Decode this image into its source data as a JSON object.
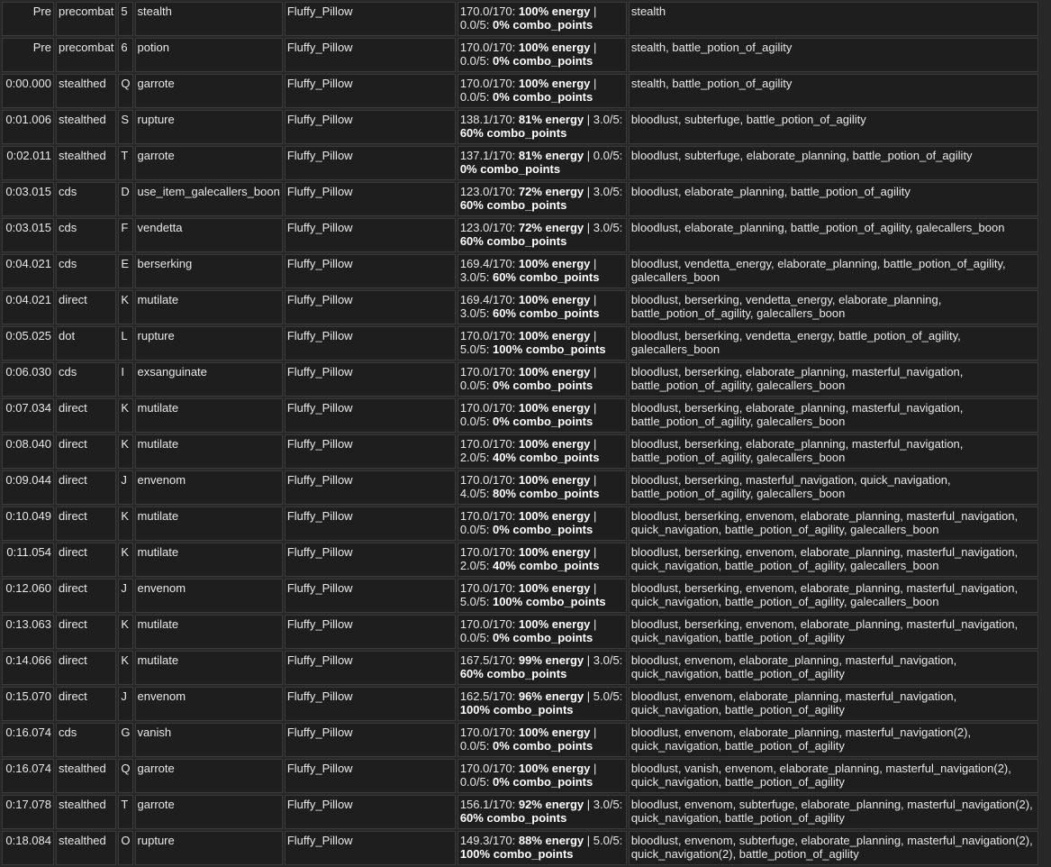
{
  "rows": [
    {
      "time": "Pre",
      "list": "precombat",
      "key": "5",
      "action": "stealth",
      "target": "Fluffy_Pillow",
      "r1": "170.0/170: ",
      "r2": "100% energy",
      "r3": " | 0.0/5: ",
      "r4": "0% combo_points",
      "buffs": "stealth"
    },
    {
      "time": "Pre",
      "list": "precombat",
      "key": "6",
      "action": "potion",
      "target": "Fluffy_Pillow",
      "r1": "170.0/170: ",
      "r2": "100% energy",
      "r3": " | 0.0/5: ",
      "r4": "0% combo_points",
      "buffs": "stealth, battle_potion_of_agility"
    },
    {
      "time": "0:00.000",
      "list": "stealthed",
      "key": "Q",
      "action": "garrote",
      "target": "Fluffy_Pillow",
      "r1": "170.0/170: ",
      "r2": "100% energy",
      "r3": " | 0.0/5: ",
      "r4": "0% combo_points",
      "buffs": "stealth, battle_potion_of_agility"
    },
    {
      "time": "0:01.006",
      "list": "stealthed",
      "key": "S",
      "action": "rupture",
      "target": "Fluffy_Pillow",
      "r1": "138.1/170: ",
      "r2": "81% energy",
      "r3": " | 3.0/5: ",
      "r4": "60% combo_points",
      "buffs": "bloodlust, subterfuge, battle_potion_of_agility"
    },
    {
      "time": "0:02.011",
      "list": "stealthed",
      "key": "T",
      "action": "garrote",
      "target": "Fluffy_Pillow",
      "r1": "137.1/170: ",
      "r2": "81% energy",
      "r3": " | 0.0/5: ",
      "r4": "0% combo_points",
      "buffs": "bloodlust, subterfuge, elaborate_planning, battle_potion_of_agility"
    },
    {
      "time": "0:03.015",
      "list": "cds",
      "key": "D",
      "action": "use_item_galecallers_boon",
      "target": "Fluffy_Pillow",
      "r1": "123.0/170: ",
      "r2": "72% energy",
      "r3": " | 3.0/5: ",
      "r4": "60% combo_points",
      "buffs": "bloodlust, elaborate_planning, battle_potion_of_agility"
    },
    {
      "time": "0:03.015",
      "list": "cds",
      "key": "F",
      "action": "vendetta",
      "target": "Fluffy_Pillow",
      "r1": "123.0/170: ",
      "r2": "72% energy",
      "r3": " | 3.0/5: ",
      "r4": "60% combo_points",
      "buffs": "bloodlust, elaborate_planning, battle_potion_of_agility, galecallers_boon"
    },
    {
      "time": "0:04.021",
      "list": "cds",
      "key": "E",
      "action": "berserking",
      "target": "Fluffy_Pillow",
      "r1": "169.4/170: ",
      "r2": "100% energy",
      "r3": " | 3.0/5: ",
      "r4": "60% combo_points",
      "buffs": "bloodlust, vendetta_energy, elaborate_planning, battle_potion_of_agility, galecallers_boon"
    },
    {
      "time": "0:04.021",
      "list": "direct",
      "key": "K",
      "action": "mutilate",
      "target": "Fluffy_Pillow",
      "r1": "169.4/170: ",
      "r2": "100% energy",
      "r3": " | 3.0/5: ",
      "r4": "60% combo_points",
      "buffs": "bloodlust, berserking, vendetta_energy, elaborate_planning, battle_potion_of_agility, galecallers_boon"
    },
    {
      "time": "0:05.025",
      "list": "dot",
      "key": "L",
      "action": "rupture",
      "target": "Fluffy_Pillow",
      "r1": "170.0/170: ",
      "r2": "100% energy",
      "r3": " | 5.0/5: ",
      "r4": "100% combo_points",
      "buffs": "bloodlust, berserking, vendetta_energy, battle_potion_of_agility, galecallers_boon"
    },
    {
      "time": "0:06.030",
      "list": "cds",
      "key": "I",
      "action": "exsanguinate",
      "target": "Fluffy_Pillow",
      "r1": "170.0/170: ",
      "r2": "100% energy",
      "r3": " | 0.0/5: ",
      "r4": "0% combo_points",
      "buffs": "bloodlust, berserking, elaborate_planning, masterful_navigation, battle_potion_of_agility, galecallers_boon"
    },
    {
      "time": "0:07.034",
      "list": "direct",
      "key": "K",
      "action": "mutilate",
      "target": "Fluffy_Pillow",
      "r1": "170.0/170: ",
      "r2": "100% energy",
      "r3": " | 0.0/5: ",
      "r4": "0% combo_points",
      "buffs": "bloodlust, berserking, elaborate_planning, masterful_navigation, battle_potion_of_agility, galecallers_boon"
    },
    {
      "time": "0:08.040",
      "list": "direct",
      "key": "K",
      "action": "mutilate",
      "target": "Fluffy_Pillow",
      "r1": "170.0/170: ",
      "r2": "100% energy",
      "r3": " | 2.0/5: ",
      "r4": "40% combo_points",
      "buffs": "bloodlust, berserking, elaborate_planning, masterful_navigation, battle_potion_of_agility, galecallers_boon"
    },
    {
      "time": "0:09.044",
      "list": "direct",
      "key": "J",
      "action": "envenom",
      "target": "Fluffy_Pillow",
      "r1": "170.0/170: ",
      "r2": "100% energy",
      "r3": " | 4.0/5: ",
      "r4": "80% combo_points",
      "buffs": "bloodlust, berserking, masterful_navigation, quick_navigation, battle_potion_of_agility, galecallers_boon"
    },
    {
      "time": "0:10.049",
      "list": "direct",
      "key": "K",
      "action": "mutilate",
      "target": "Fluffy_Pillow",
      "r1": "170.0/170: ",
      "r2": "100% energy",
      "r3": " | 0.0/5: ",
      "r4": "0% combo_points",
      "buffs": "bloodlust, berserking, envenom, elaborate_planning, masterful_navigation, quick_navigation, battle_potion_of_agility, galecallers_boon"
    },
    {
      "time": "0:11.054",
      "list": "direct",
      "key": "K",
      "action": "mutilate",
      "target": "Fluffy_Pillow",
      "r1": "170.0/170: ",
      "r2": "100% energy",
      "r3": " | 2.0/5: ",
      "r4": "40% combo_points",
      "buffs": "bloodlust, berserking, envenom, elaborate_planning, masterful_navigation, quick_navigation, battle_potion_of_agility, galecallers_boon"
    },
    {
      "time": "0:12.060",
      "list": "direct",
      "key": "J",
      "action": "envenom",
      "target": "Fluffy_Pillow",
      "r1": "170.0/170: ",
      "r2": "100% energy",
      "r3": " | 5.0/5: ",
      "r4": "100% combo_points",
      "buffs": "bloodlust, berserking, envenom, elaborate_planning, masterful_navigation, quick_navigation, battle_potion_of_agility, galecallers_boon"
    },
    {
      "time": "0:13.063",
      "list": "direct",
      "key": "K",
      "action": "mutilate",
      "target": "Fluffy_Pillow",
      "r1": "170.0/170: ",
      "r2": "100% energy",
      "r3": " | 0.0/5: ",
      "r4": "0% combo_points",
      "buffs": "bloodlust, berserking, envenom, elaborate_planning, masterful_navigation, quick_navigation, battle_potion_of_agility"
    },
    {
      "time": "0:14.066",
      "list": "direct",
      "key": "K",
      "action": "mutilate",
      "target": "Fluffy_Pillow",
      "r1": "167.5/170: ",
      "r2": "99% energy",
      "r3": " | 3.0/5: ",
      "r4": "60% combo_points",
      "buffs": "bloodlust, envenom, elaborate_planning, masterful_navigation, quick_navigation, battle_potion_of_agility"
    },
    {
      "time": "0:15.070",
      "list": "direct",
      "key": "J",
      "action": "envenom",
      "target": "Fluffy_Pillow",
      "r1": "162.5/170: ",
      "r2": "96% energy",
      "r3": " | 5.0/5: ",
      "r4": "100% combo_points",
      "buffs": "bloodlust, envenom, elaborate_planning, masterful_navigation, quick_navigation, battle_potion_of_agility"
    },
    {
      "time": "0:16.074",
      "list": "cds",
      "key": "G",
      "action": "vanish",
      "target": "Fluffy_Pillow",
      "r1": "170.0/170: ",
      "r2": "100% energy",
      "r3": " | 0.0/5: ",
      "r4": "0% combo_points",
      "buffs": "bloodlust, envenom, elaborate_planning, masterful_navigation(2), quick_navigation, battle_potion_of_agility"
    },
    {
      "time": "0:16.074",
      "list": "stealthed",
      "key": "Q",
      "action": "garrote",
      "target": "Fluffy_Pillow",
      "r1": "170.0/170: ",
      "r2": "100% energy",
      "r3": " | 0.0/5: ",
      "r4": "0% combo_points",
      "buffs": "bloodlust, vanish, envenom, elaborate_planning, masterful_navigation(2), quick_navigation, battle_potion_of_agility"
    },
    {
      "time": "0:17.078",
      "list": "stealthed",
      "key": "T",
      "action": "garrote",
      "target": "Fluffy_Pillow",
      "r1": "156.1/170: ",
      "r2": "92% energy",
      "r3": " | 3.0/5: ",
      "r4": "60% combo_points",
      "buffs": "bloodlust, envenom, subterfuge, elaborate_planning, masterful_navigation(2), quick_navigation, battle_potion_of_agility"
    },
    {
      "time": "0:18.084",
      "list": "stealthed",
      "key": "O",
      "action": "rupture",
      "target": "Fluffy_Pillow",
      "r1": "149.3/170: ",
      "r2": "88% energy",
      "r3": " | 5.0/5: ",
      "r4": "100% combo_points",
      "buffs": "bloodlust, envenom, subterfuge, elaborate_planning, masterful_navigation(2), quick_navigation(2), battle_potion_of_agility"
    }
  ]
}
